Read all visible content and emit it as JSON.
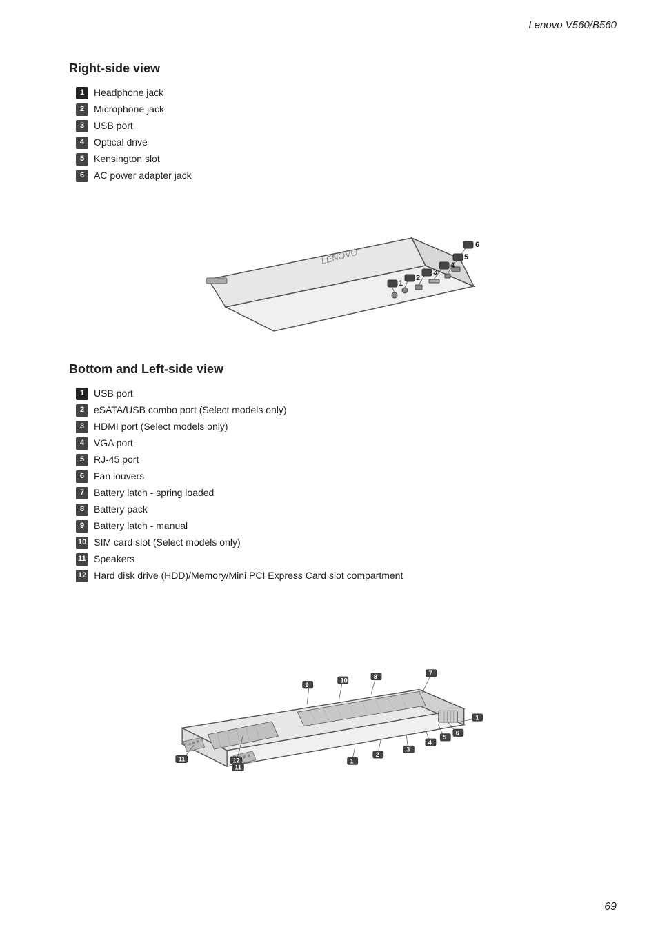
{
  "header": {
    "title": "Lenovo V560/B560"
  },
  "right_side": {
    "section_title": "Right-side view",
    "items": [
      {
        "num": "1",
        "label": "Headphone jack"
      },
      {
        "num": "2",
        "label": "Microphone jack"
      },
      {
        "num": "3",
        "label": "USB port"
      },
      {
        "num": "4",
        "label": "Optical drive"
      },
      {
        "num": "5",
        "label": "Kensington slot"
      },
      {
        "num": "6",
        "label": "AC power adapter jack"
      }
    ]
  },
  "bottom_left": {
    "section_title": "Bottom and Left-side view",
    "items": [
      {
        "num": "1",
        "label": "USB port"
      },
      {
        "num": "2",
        "label": "eSATA/USB combo port (Select models only)"
      },
      {
        "num": "3",
        "label": "HDMI port (Select models only)"
      },
      {
        "num": "4",
        "label": "VGA port"
      },
      {
        "num": "5",
        "label": "RJ-45 port"
      },
      {
        "num": "6",
        "label": "Fan louvers"
      },
      {
        "num": "7",
        "label": "Battery latch - spring loaded"
      },
      {
        "num": "8",
        "label": "Battery pack"
      },
      {
        "num": "9",
        "label": "Battery latch - manual"
      },
      {
        "num": "10",
        "label": "SIM card slot (Select models only)"
      },
      {
        "num": "11",
        "label": "Speakers"
      },
      {
        "num": "12",
        "label": "Hard disk drive (HDD)/Memory/Mini PCI Express Card slot compartment"
      }
    ]
  },
  "page_number": "69"
}
